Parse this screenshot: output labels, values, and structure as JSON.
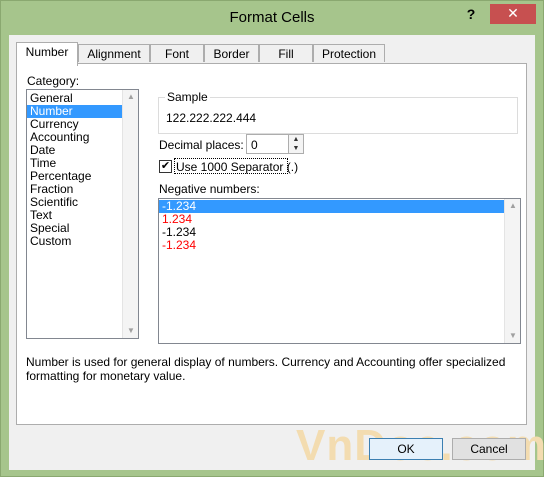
{
  "window": {
    "title": "Format Cells",
    "help_label": "?",
    "close_label": "✕"
  },
  "tabs": [
    {
      "label": "Number",
      "active": true
    },
    {
      "label": "Alignment",
      "active": false
    },
    {
      "label": "Font",
      "active": false
    },
    {
      "label": "Border",
      "active": false
    },
    {
      "label": "Fill",
      "active": false
    },
    {
      "label": "Protection",
      "active": false
    }
  ],
  "category": {
    "label": "Category:",
    "items": [
      "General",
      "Number",
      "Currency",
      "Accounting",
      "Date",
      "Time",
      "Percentage",
      "Fraction",
      "Scientific",
      "Text",
      "Special",
      "Custom"
    ],
    "selected": "Number"
  },
  "sample": {
    "label": "Sample",
    "value": "122.222.222.444"
  },
  "decimal_places": {
    "label": "Decimal places:",
    "value": "0"
  },
  "separator": {
    "label": "Use 1000 Separator (.)",
    "checked": true,
    "check_glyph": "✔"
  },
  "negative_numbers": {
    "label": "Negative numbers:",
    "items": [
      {
        "text": "-1.234",
        "color": "#000000",
        "selected": true
      },
      {
        "text": "1.234",
        "color": "#ff0000",
        "selected": false
      },
      {
        "text": "-1.234",
        "color": "#000000",
        "selected": false
      },
      {
        "text": "-1.234",
        "color": "#ff0000",
        "selected": false
      }
    ]
  },
  "description": "Number is used for general display of numbers.  Currency and Accounting offer specialized formatting for monetary value.",
  "buttons": {
    "ok": "OK",
    "cancel": "Cancel"
  },
  "watermark": "VnDoc.com",
  "scroll": {
    "up_glyph": "▲",
    "down_glyph": "▼"
  },
  "colors": {
    "selection": "#3399ff",
    "frame": "#a6c58c",
    "close": "#c75050",
    "negative_red": "#ff0000"
  }
}
